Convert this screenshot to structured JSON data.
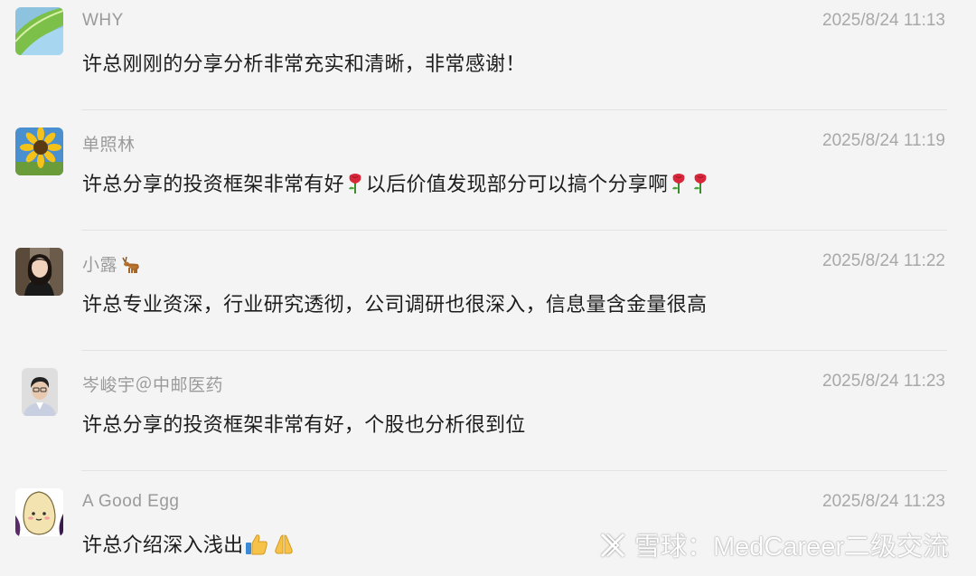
{
  "comments": [
    {
      "name": "WHY",
      "time": "2025/8/24 11:13",
      "text": "许总刚刚的分享分析非常充实和清晰，非常感谢！",
      "avatar_icon": "leaf-avatar"
    },
    {
      "name": "单照林",
      "time": "2025/8/24 11:19",
      "text_parts": [
        "许总分享的投资框架非常有好",
        "以后价值发现部分可以搞个分享啊"
      ],
      "emoji": "rose-emoji",
      "avatar_icon": "sunflower-avatar"
    },
    {
      "name": "小露",
      "name_emoji": "deer-emoji",
      "time": "2025/8/24 11:22",
      "text": "许总专业资深，行业研究透彻，公司调研也很深入，信息量含金量很高",
      "avatar_icon": "woman-portrait-avatar"
    },
    {
      "name": "岑峻宇＠中邮医药",
      "time": "2025/8/24 11:23",
      "text": "许总分享的投资框架非常有好，个股也分析很到位",
      "avatar_icon": "man-portrait-avatar"
    },
    {
      "name": "A Good Egg",
      "time": "2025/8/24 11:23",
      "text": "许总介绍深入浅出",
      "emojis": [
        "thumbs-up-emoji",
        "pray-emoji"
      ],
      "avatar_icon": "egg-avatar"
    }
  ],
  "watermark": {
    "text": "雪球：MedCareer二级交流",
    "icon": "xueqiu-logo-icon"
  },
  "colors": {
    "background": "#f4f4f4",
    "name": "#9a9a9a",
    "time": "#a8a8a8",
    "text": "#1d1d1d",
    "divider": "#e2e2e2"
  }
}
